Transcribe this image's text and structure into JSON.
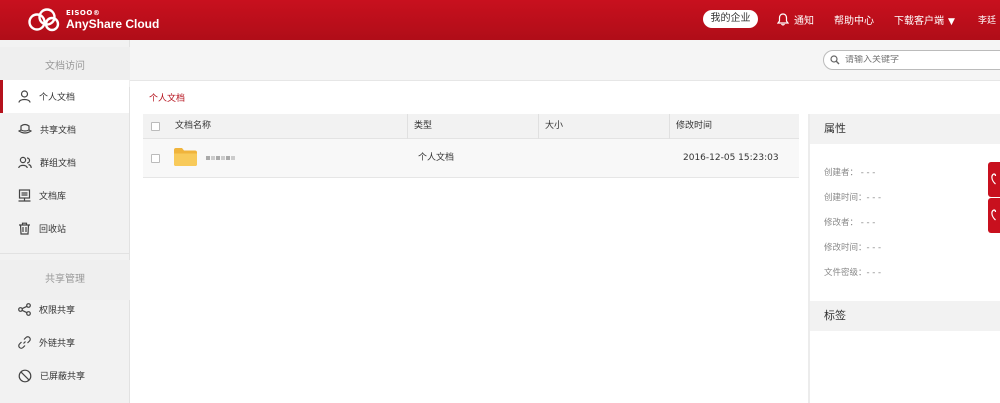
{
  "header": {
    "logo_small": "EISOO®",
    "logo_big": "AnyShare Cloud",
    "enterprise_btn": "我的企业",
    "notify": "通知",
    "help": "帮助中心",
    "download": "下载客户端",
    "user": "李廷"
  },
  "sidebar": {
    "section1": "文档访问",
    "items1": [
      {
        "label": "个人文档",
        "icon": "user-icon"
      },
      {
        "label": "共享文档",
        "icon": "hat-icon"
      },
      {
        "label": "群组文档",
        "icon": "group-icon"
      },
      {
        "label": "文档库",
        "icon": "library-icon"
      },
      {
        "label": "回收站",
        "icon": "trash-icon"
      }
    ],
    "section2": "共享管理",
    "items2": [
      {
        "label": "权限共享",
        "icon": "share-icon"
      },
      {
        "label": "外链共享",
        "icon": "link-icon"
      },
      {
        "label": "已屏蔽共享",
        "icon": "blocked-icon"
      }
    ]
  },
  "search": {
    "placeholder": "请输入关键字"
  },
  "breadcrumb": "个人文档",
  "table": {
    "headers": [
      "文档名称",
      "类型",
      "大小",
      "修改时间"
    ],
    "rows": [
      {
        "type": "个人文档",
        "size": "",
        "modified": "2016-12-05 15:23:03"
      }
    ]
  },
  "properties": {
    "title": "属性",
    "items": [
      {
        "label": "创建者：",
        "value": "- - -"
      },
      {
        "label": "创建时间：",
        "value": "- - -"
      },
      {
        "label": "修改者：",
        "value": "- - -"
      },
      {
        "label": "修改时间：",
        "value": "- - -"
      },
      {
        "label": "文件密级：",
        "value": "- - -"
      }
    ],
    "tags_title": "标签"
  },
  "colors": {
    "brand": "#c8101e",
    "accent_text": "#b5111c"
  }
}
